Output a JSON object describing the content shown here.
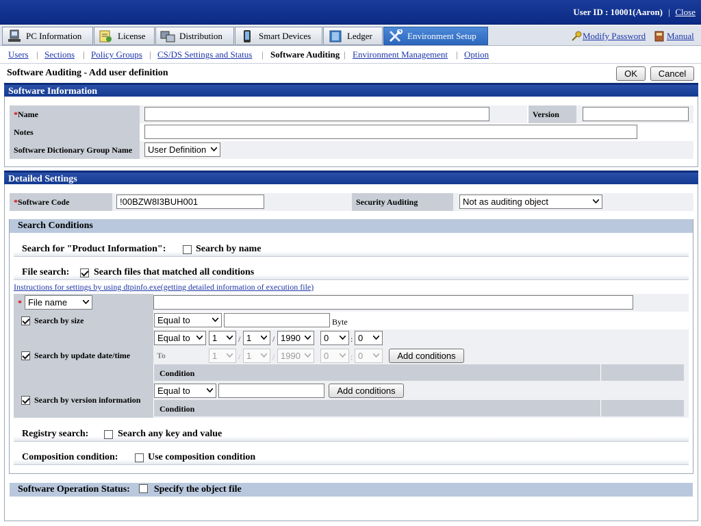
{
  "topbar": {
    "user_id": "User ID : 10001(Aaron)",
    "close": "Close"
  },
  "tabs": [
    {
      "label": "PC Information",
      "icon": "pc-icon"
    },
    {
      "label": "License",
      "icon": "license-icon"
    },
    {
      "label": "Distribution",
      "icon": "distribution-icon"
    },
    {
      "label": "Smart Devices",
      "icon": "smart-device-icon"
    },
    {
      "label": "Ledger",
      "icon": "ledger-icon"
    },
    {
      "label": "Environment Setup",
      "icon": "tools-icon",
      "active": true
    }
  ],
  "toplinks": {
    "modify_password": "Modify Password",
    "manual": "Manual"
  },
  "subnav": [
    "Users",
    "Sections",
    "Policy Groups",
    "CS/DS Settings and Status",
    "Software Auditing",
    "Environment Management",
    "Option"
  ],
  "page": {
    "title": "Software Auditing - Add user definition",
    "ok": "OK",
    "cancel": "Cancel"
  },
  "software_info": {
    "header": "Software Information",
    "name_label": "Name",
    "name_value": "",
    "version_label": "Version",
    "version_value": "",
    "notes_label": "Notes",
    "notes_value": "",
    "dict_group_label": "Software Dictionary Group Name",
    "dict_group_value": "User Definition"
  },
  "detailed": {
    "header": "Detailed Settings",
    "code_label": "Software Code",
    "code_value": "!00BZW8I3BUH001",
    "security_label": "Security Auditing",
    "security_value": "Not as auditing object"
  },
  "search": {
    "header": "Search Conditions",
    "product_label": "Search for \"Product Information\":",
    "product_check_label": "Search by name",
    "product_checked": false,
    "file_label": "File search:",
    "file_check_label": "Search files that matched all conditions",
    "file_checked": true,
    "instructions_link": "Instructions for settings by using dtpinfo.exe(getting detailed information of execution file)",
    "file_type": "File name",
    "file_value": "",
    "size_label": "Search by size",
    "size_checked": true,
    "size_op": "Equal to",
    "size_value": "",
    "size_unit": "Byte",
    "date_label": "Search by update date/time",
    "date_checked": true,
    "date_op": "Equal to",
    "date_from": {
      "month": "1",
      "day": "1",
      "year": "1990",
      "hour": "0",
      "minute": "0"
    },
    "to_label": "To",
    "date_to": {
      "month": "1",
      "day": "1",
      "year": "1990",
      "hour": "0",
      "minute": "0"
    },
    "add_conditions": "Add conditions",
    "condition_header": "Condition",
    "version_label": "Search by version information",
    "version_checked": true,
    "version_op": "Equal to",
    "version_value": "",
    "registry_label": "Registry search:",
    "registry_check_label": "Search any key and value",
    "registry_checked": false,
    "composition_label": "Composition condition:",
    "composition_check_label": "Use composition condition",
    "composition_checked": false
  },
  "operation": {
    "label": "Software Operation Status:",
    "check_label": "Specify the object file",
    "checked": false
  },
  "colors": {
    "header_blue": "#143a90",
    "link_blue": "#1d35a8",
    "label_gray": "#c9ced6",
    "required_red": "#d00000",
    "subheader_blue": "#b9c8dd"
  }
}
